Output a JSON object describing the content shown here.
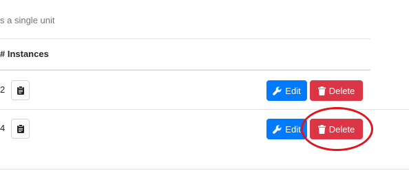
{
  "header": {
    "subtitle": "s a single unit",
    "column_instances": "# Instances"
  },
  "rows": [
    {
      "instances": "2",
      "edit_label": "Edit",
      "delete_label": "Delete"
    },
    {
      "instances": "4",
      "edit_label": "Edit",
      "delete_label": "Delete"
    }
  ],
  "icons": {
    "clipboard": "clipboard-icon",
    "wrench": "wrench-icon",
    "trash": "trash-icon"
  },
  "colors": {
    "edit_button": "#007bff",
    "delete_button": "#dc3545",
    "highlight_annotation": "#e0141e"
  }
}
